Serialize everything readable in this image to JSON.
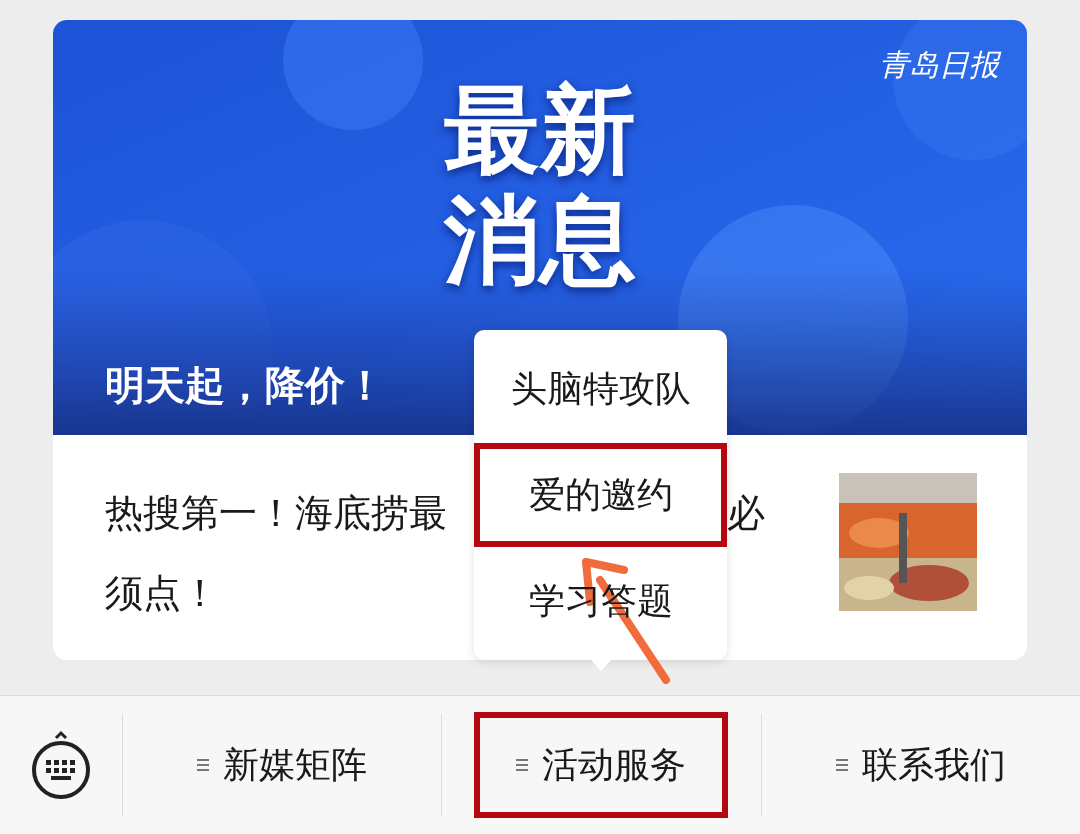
{
  "banner": {
    "headline": [
      "最新",
      "消息"
    ],
    "logo": "青岛日报",
    "caption": "明天起，降价！"
  },
  "article": {
    "title_lines": [
      "热搜第一！海底捞最",
      "必",
      "须点！"
    ]
  },
  "popup_menu": {
    "items": [
      {
        "label": "头脑特攻队",
        "selected": false
      },
      {
        "label": "爱的邀约",
        "selected": true
      },
      {
        "label": "学习答题",
        "selected": false
      }
    ]
  },
  "bottom_menu": {
    "items": [
      {
        "label": "新媒矩阵",
        "selected": false
      },
      {
        "label": "活动服务",
        "selected": true
      },
      {
        "label": "联系我们",
        "selected": false
      }
    ]
  }
}
